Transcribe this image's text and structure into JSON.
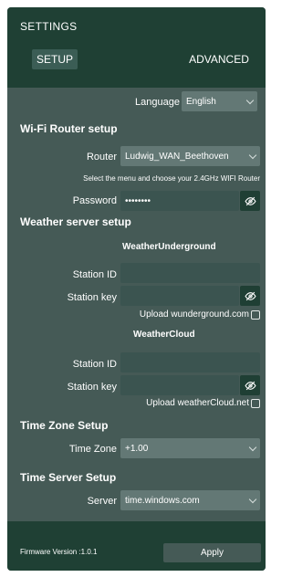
{
  "header": {
    "title": "SETTINGS",
    "tabs": [
      {
        "label": "SETUP",
        "active": true
      },
      {
        "label": "ADVANCED",
        "active": false
      }
    ]
  },
  "language": {
    "label": "Language",
    "value": "English"
  },
  "wifi": {
    "section_title": "Wi-Fi Router setup",
    "router_label": "Router",
    "router_value": "Ludwig_WAN_Beethoven",
    "note": "Select the menu and choose your 2.4GHz WIFI Router",
    "password_label": "Password",
    "password_value": "••••••••"
  },
  "weather": {
    "section_title": "Weather server setup",
    "wunderground": {
      "title": "WeatherUnderground",
      "station_id_label": "Station ID",
      "station_id_value": "",
      "station_key_label": "Station key",
      "station_key_value": "",
      "upload_label": "Upload wunderground.com",
      "upload_checked": false
    },
    "weathercloud": {
      "title": "WeatherCloud",
      "station_id_label": "Station ID",
      "station_id_value": "",
      "station_key_label": "Station key",
      "station_key_value": "",
      "upload_label": "Upload weatherCloud.net",
      "upload_checked": false
    }
  },
  "timezone": {
    "section_title": "Time Zone Setup",
    "label": "Time Zone",
    "value": "+1.00"
  },
  "timeserver": {
    "section_title": "Time Server Setup",
    "label": "Server",
    "value": "time.windows.com"
  },
  "footer": {
    "firmware": "Firmware Version :1.0.1",
    "apply_label": "Apply"
  },
  "icons": {
    "eye": "eye-slash-icon",
    "chevron": "chevron-down-icon"
  },
  "colors": {
    "panel": "#455a56",
    "header": "#1f4034",
    "select": "#637875",
    "input": "#3b5450"
  }
}
